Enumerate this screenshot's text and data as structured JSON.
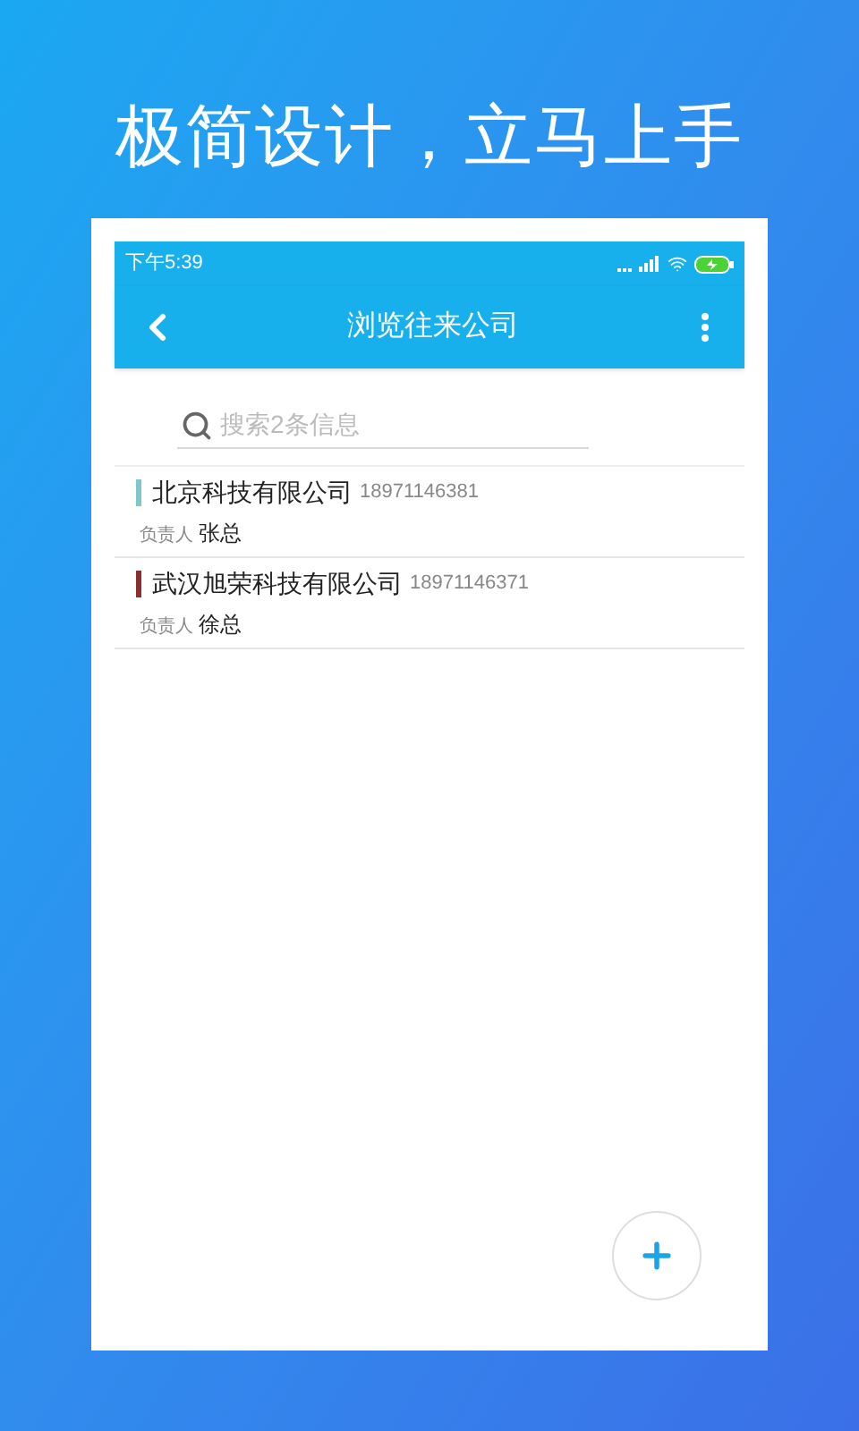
{
  "headline": "极简设计，立马上手",
  "status_bar": {
    "time": "下午5:39"
  },
  "toolbar": {
    "title": "浏览往来公司"
  },
  "search": {
    "placeholder": "搜索2条信息"
  },
  "companies": [
    {
      "name": "北京科技有限公司",
      "phone": "18971146381",
      "owner_label": "负责人",
      "owner": "张总",
      "color": "#7ec8c8"
    },
    {
      "name": "武汉旭荣科技有限公司",
      "phone": "18971146371",
      "owner_label": "负责人",
      "owner": "徐总",
      "color": "#8b2e2e"
    }
  ]
}
